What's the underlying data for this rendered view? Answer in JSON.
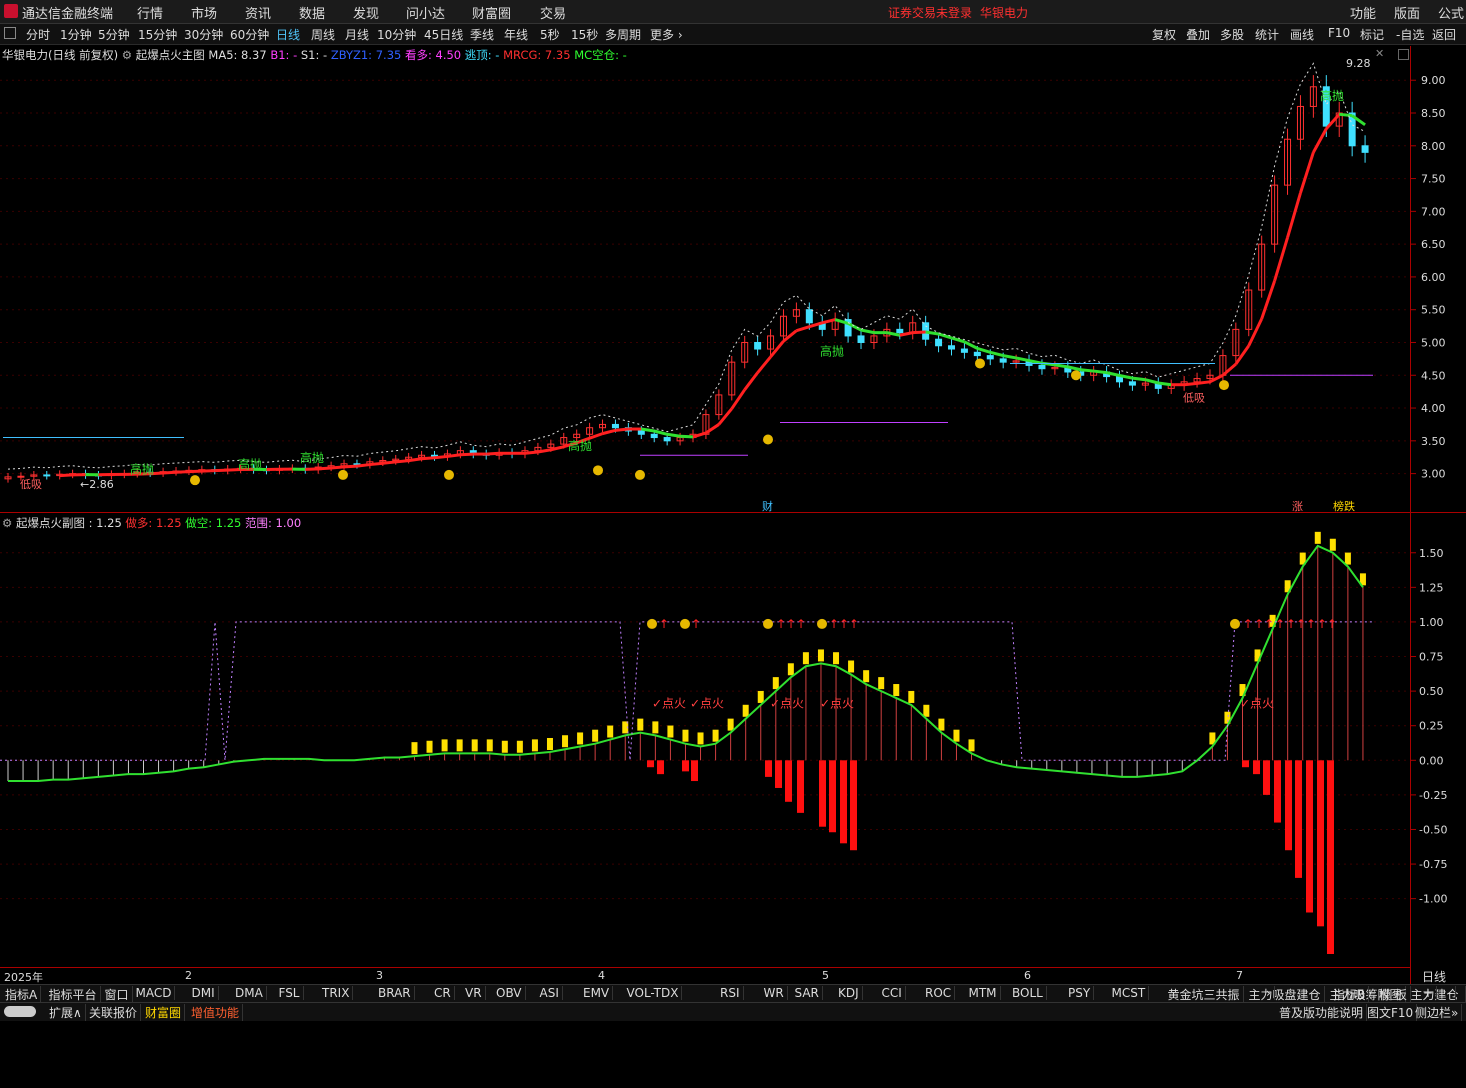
{
  "app": {
    "name": "通达信金融终端",
    "login_warning": "证券交易未登录",
    "stock_name": "华银电力"
  },
  "menu": [
    "行情",
    "市场",
    "资讯",
    "数据",
    "发现",
    "问小达",
    "财富圈",
    "交易"
  ],
  "menu_right": [
    "功能",
    "版面",
    "公式"
  ],
  "timeframes": [
    "分时",
    "1分钟",
    "5分钟",
    "15分钟",
    "30分钟",
    "60分钟",
    "日线",
    "周线",
    "月线",
    "10分钟",
    "45日线",
    "季线",
    "年线",
    "5秒",
    "15秒",
    "多周期",
    "更多"
  ],
  "active_timeframe": "日线",
  "toolbar_right": [
    "复权",
    "叠加",
    "多股",
    "统计",
    "画线",
    "F10",
    "标记",
    "-自选",
    "返回"
  ],
  "main_header": {
    "stock": "华银电力(日线 前复权)",
    "indicator": "起爆点火主图",
    "ma5": "MA5: 8.37",
    "b1": "B1: -",
    "s1": "S1: -",
    "zbyz1": "ZBYZ1: 7.35",
    "kanduo": "看多: 4.50",
    "taoding": "逃顶: -",
    "mrcg": "MRCG: 7.35",
    "mckc": "MC空仓: -"
  },
  "main_y_ticks": [
    "9.00",
    "8.50",
    "8.00",
    "7.50",
    "7.00",
    "6.50",
    "6.00",
    "5.50",
    "5.00",
    "4.50",
    "4.00",
    "3.50",
    "3.00"
  ],
  "main_annotations": {
    "high": "9.28",
    "low": "2.86",
    "gaopao": "高抛",
    "dixi": "低吸",
    "cai": "财",
    "zhang": "涨",
    "bangdie": "榜跌"
  },
  "sub_header": {
    "name": "起爆点火副图",
    "value": ": 1.25",
    "zuoduo": "做多: 1.25",
    "zuokong": "做空: 1.25",
    "fanwei": "范围: 1.00"
  },
  "sub_y_ticks": [
    "1.50",
    "1.25",
    "1.00",
    "0.75",
    "0.50",
    "0.25",
    "0.00",
    "-0.25",
    "-0.50",
    "-0.75",
    "-1.00"
  ],
  "sub_annotations": {
    "dianhuo": "点火"
  },
  "x_axis": {
    "labels": [
      "2025年",
      "2",
      "3",
      "4",
      "5",
      "6",
      "7"
    ],
    "period": "日线"
  },
  "indicator_tabs": [
    "指标A",
    "指标平台",
    "窗口",
    "MACD",
    "DMI",
    "DMA",
    "FSL",
    "TRIX",
    "BRAR",
    "CR",
    "VR",
    "OBV",
    "ASI",
    "EMV",
    "VOL-TDX",
    "RSI",
    "WR",
    "SAR",
    "KDJ",
    "CCI",
    "ROC",
    "MTM",
    "BOLL",
    "PSY",
    "MCST",
    "黄金坑三共振",
    "主力吸盘建仓",
    "主力吸筹附图",
    "主力建仓副图",
    "起爆点火副图"
  ],
  "selected_indicator_tab": "起爆点火副图",
  "bottom_right": [
    "指标B",
    "模 板",
    "+",
    "-"
  ],
  "status_bar": {
    "items": [
      "扩展∧",
      "关联报价",
      "财富圈",
      "增值功能"
    ],
    "right": [
      "普及版功能说明",
      "图文F10",
      "侧边栏»"
    ]
  },
  "chart_data": [
    {
      "type": "candlestick",
      "title": "华银电力(日线 前复权)",
      "ylim": [
        2.75,
        9.4
      ],
      "close_series": [
        2.95,
        2.96,
        2.98,
        2.97,
        2.99,
        3.0,
        2.98,
        2.97,
        2.99,
        3.0,
        3.02,
        3.01,
        3.03,
        3.04,
        3.05,
        3.06,
        3.05,
        3.07,
        3.08,
        3.06,
        3.05,
        3.07,
        3.08,
        3.06,
        3.1,
        3.12,
        3.15,
        3.14,
        3.18,
        3.2,
        3.22,
        3.25,
        3.28,
        3.26,
        3.3,
        3.35,
        3.3,
        3.28,
        3.32,
        3.3,
        3.35,
        3.4,
        3.45,
        3.55,
        3.6,
        3.7,
        3.75,
        3.7,
        3.65,
        3.6,
        3.55,
        3.5,
        3.55,
        3.6,
        3.9,
        4.2,
        4.7,
        5.0,
        4.9,
        5.1,
        5.4,
        5.5,
        5.3,
        5.2,
        5.35,
        5.1,
        5.0,
        5.1,
        5.2,
        5.15,
        5.3,
        5.05,
        4.95,
        4.9,
        4.85,
        4.8,
        4.75,
        4.7,
        4.72,
        4.65,
        4.6,
        4.62,
        4.55,
        4.5,
        4.55,
        4.48,
        4.4,
        4.35,
        4.38,
        4.3,
        4.35,
        4.4,
        4.45,
        4.5,
        4.8,
        5.2,
        5.8,
        6.5,
        7.4,
        8.1,
        8.6,
        8.9,
        8.3,
        8.5,
        8.0,
        7.9
      ]
    },
    {
      "type": "bar",
      "title": "起爆点火副图",
      "ylim": [
        -1.4,
        1.65
      ],
      "values": [
        -0.15,
        -0.15,
        -0.15,
        -0.14,
        -0.14,
        -0.13,
        -0.12,
        -0.11,
        -0.1,
        -0.1,
        -0.09,
        -0.08,
        -0.06,
        -0.05,
        -0.03,
        -0.01,
        0.0,
        0.01,
        0.01,
        0.01,
        0.01,
        0.0,
        0.0,
        0.0,
        0.01,
        0.02,
        0.02,
        0.03,
        0.04,
        0.05,
        0.05,
        0.05,
        0.05,
        0.04,
        0.04,
        0.05,
        0.06,
        0.08,
        0.1,
        0.12,
        0.15,
        0.18,
        0.2,
        0.18,
        0.15,
        0.12,
        0.1,
        0.12,
        0.2,
        0.3,
        0.4,
        0.5,
        0.6,
        0.68,
        0.7,
        0.68,
        0.62,
        0.55,
        0.5,
        0.45,
        0.4,
        0.3,
        0.2,
        0.12,
        0.05,
        0.0,
        -0.03,
        -0.05,
        -0.06,
        -0.07,
        -0.08,
        -0.09,
        -0.1,
        -0.11,
        -0.12,
        -0.12,
        -0.11,
        -0.1,
        -0.08,
        0.0,
        0.1,
        0.25,
        0.45,
        0.7,
        0.95,
        1.2,
        1.4,
        1.55,
        1.5,
        1.4,
        1.25
      ]
    }
  ]
}
